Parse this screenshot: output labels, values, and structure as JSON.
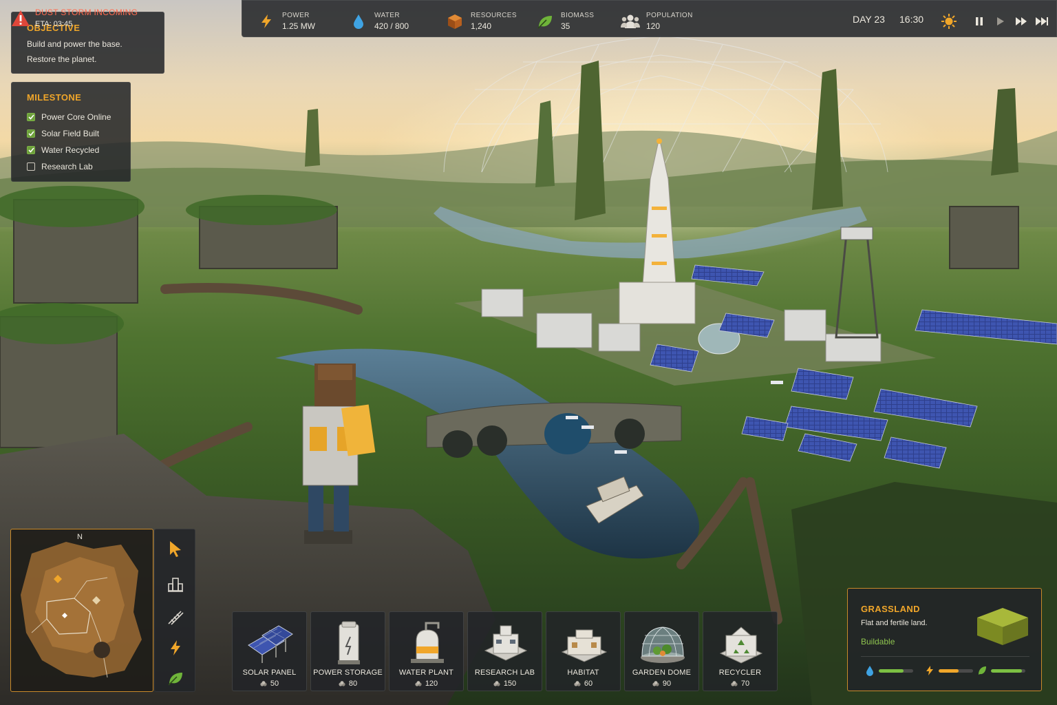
{
  "topbar": {
    "stats": [
      {
        "label": "POWER",
        "value": "1.25 MW",
        "icon": "lightning-icon"
      },
      {
        "label": "WATER",
        "value": "420 / 800",
        "icon": "water-drop-icon"
      },
      {
        "label": "RESOURCES",
        "value": "1,240",
        "icon": "crate-icon"
      },
      {
        "label": "BIOMASS",
        "value": "35",
        "icon": "leaf-icon"
      },
      {
        "label": "POPULATION",
        "value": "120",
        "icon": "people-icon"
      }
    ],
    "day": "DAY 23",
    "time": "16:30",
    "weather_icon": "sun-icon",
    "controls": [
      "pause-icon",
      "play-icon",
      "fast-forward-icon",
      "fastest-icon"
    ]
  },
  "objective": {
    "title": "OBJECTIVE",
    "line1": "Build and power the base.",
    "line2": "Restore the planet."
  },
  "milestone": {
    "title": "MILESTONE",
    "items": [
      {
        "label": "Power Core Online",
        "done": true
      },
      {
        "label": "Solar Field Built",
        "done": true
      },
      {
        "label": "Water Recycled",
        "done": true
      },
      {
        "label": "Research Lab",
        "done": false
      }
    ]
  },
  "alert": {
    "title": "DUST STORM INCOMING",
    "eta": "ETA: 03:45",
    "icon": "warning-icon"
  },
  "minimap": {
    "north": "N"
  },
  "tools": [
    "cursor-icon",
    "building-icon",
    "road-icon",
    "power-icon",
    "nature-icon"
  ],
  "build": [
    {
      "name": "SOLAR PANEL",
      "cost": "50"
    },
    {
      "name": "POWER STORAGE",
      "cost": "80"
    },
    {
      "name": "WATER PLANT",
      "cost": "120"
    },
    {
      "name": "RESEARCH LAB",
      "cost": "150"
    },
    {
      "name": "HABITAT",
      "cost": "60"
    },
    {
      "name": "GARDEN DOME",
      "cost": "90"
    },
    {
      "name": "RECYCLER",
      "cost": "70"
    }
  ],
  "tile": {
    "title": "GRASSLAND",
    "desc": "Flat and fertile land.",
    "status": "Buildable",
    "bars": [
      {
        "icon": "water-drop-icon",
        "level": 0.72,
        "color": "#7cc043"
      },
      {
        "icon": "lightning-icon",
        "level": 0.58,
        "color": "#f0a62a"
      },
      {
        "icon": "leaf-icon",
        "level": 0.9,
        "color": "#7cc043"
      }
    ]
  },
  "colors": {
    "accent": "#f0a62a",
    "alert": "#ff6a4f",
    "buildable": "#8fc44f"
  }
}
